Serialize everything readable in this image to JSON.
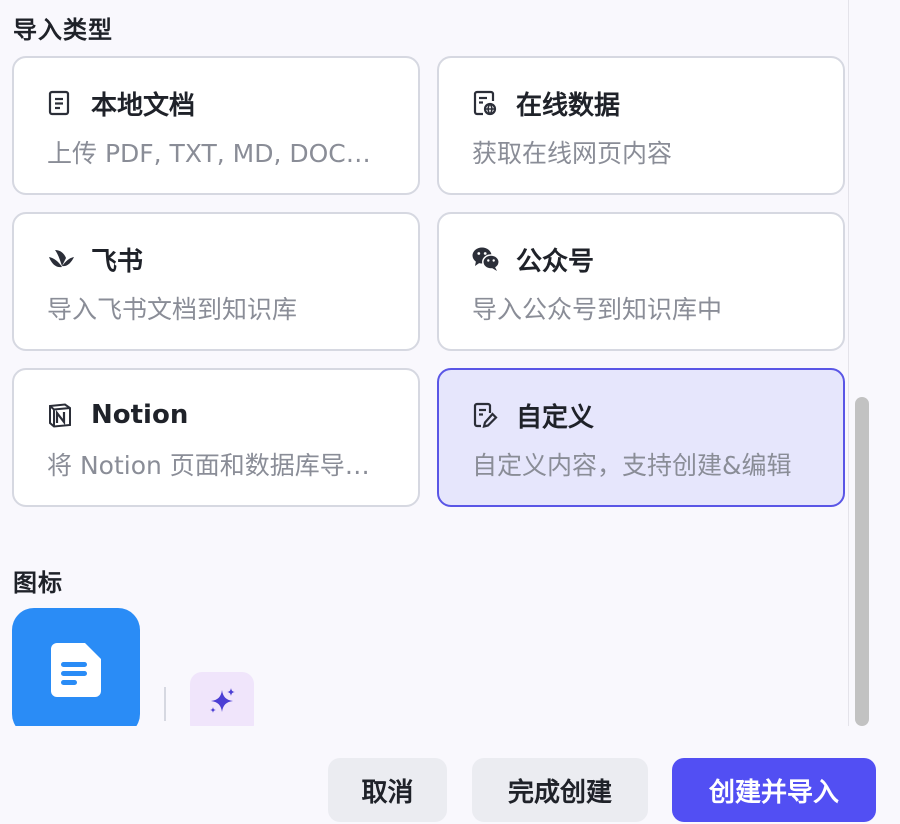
{
  "sections": {
    "import_type": "导入类型",
    "icon": "图标"
  },
  "cards": [
    {
      "title": "本地文档",
      "desc": "上传 PDF, TXT, MD, DOC…",
      "icon": "document-icon"
    },
    {
      "title": "在线数据",
      "desc": "获取在线网页内容",
      "icon": "web-data-icon"
    },
    {
      "title": "飞书",
      "desc": "导入飞书文档到知识库",
      "icon": "feishu-icon"
    },
    {
      "title": "公众号",
      "desc": "导入公众号到知识库中",
      "icon": "wechat-icon"
    },
    {
      "title": "Notion",
      "desc": "将 Notion 页面和数据库导…",
      "icon": "notion-icon"
    },
    {
      "title": "自定义",
      "desc": "自定义内容，支持创建&编辑",
      "icon": "custom-edit-icon",
      "selected": true
    }
  ],
  "icon_picker": {
    "main_icon": "file-text-icon",
    "ai_icon": "sparkle-icon",
    "main_color": "#2a8cf6"
  },
  "footer": {
    "cancel": "取消",
    "finish": "完成创建",
    "create_import": "创建并导入"
  },
  "colors": {
    "accent": "#524ff3",
    "selected_bg": "#e6e6fc",
    "selected_border": "#5a56e6"
  }
}
